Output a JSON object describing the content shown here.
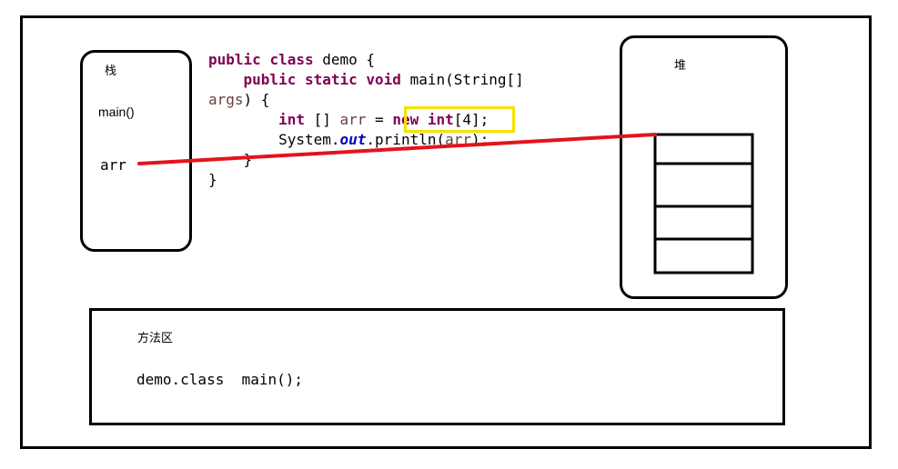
{
  "stack": {
    "title": "栈",
    "frame_label": "main()",
    "variable": "arr"
  },
  "heap": {
    "title": "堆",
    "array_cells": 4
  },
  "method_area": {
    "title": "方法区",
    "content": "demo.class  main();"
  },
  "code": {
    "line1": {
      "kw1": "public",
      "kw2": "class",
      "rest": " demo {"
    },
    "line2": {
      "indent": "    ",
      "kw1": "public",
      "kw2": "static",
      "kw3": "void",
      "rest": " main(String[]"
    },
    "line3": {
      "param": "args",
      "rest": ") {"
    },
    "line4": {
      "indent": "        ",
      "kw1": "int",
      "mid": " [] ",
      "var": "arr",
      "eq": " = ",
      "kw2": "new",
      "kw3": "int",
      "rest": "[4];"
    },
    "line5": {
      "indent": "        ",
      "pre": "System.",
      "field": "out",
      "mid": ".println(",
      "var": "arr",
      "rest": ");"
    },
    "line6": {
      "indent": "    ",
      "text": "}"
    },
    "line7": {
      "text": "}"
    }
  },
  "colors": {
    "keyword": "#7f0055",
    "highlight_border": "#f5e000",
    "reference_line": "#e3141b",
    "field": "#0000c0",
    "param": "#6a3e3e"
  }
}
